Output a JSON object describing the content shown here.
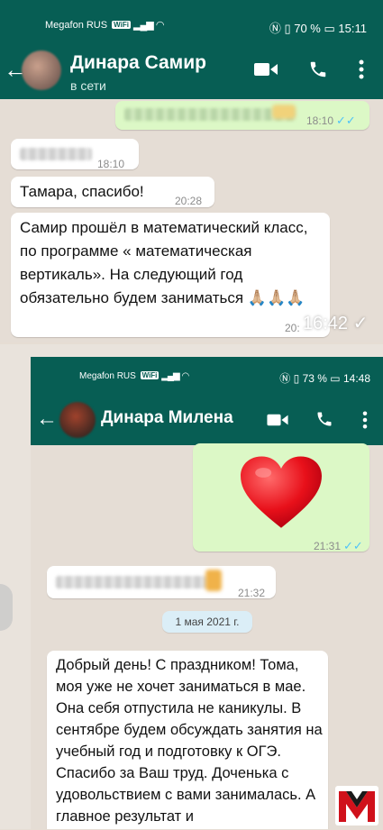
{
  "shot1": {
    "status": {
      "carrier": "Megafon RUS",
      "wifi_badge": "WiFi",
      "battery": "70 %",
      "time": "15:11"
    },
    "header": {
      "name": "Динара Самир",
      "status": "в сети"
    },
    "messages": [
      {
        "time": "18:10"
      },
      {
        "time": "18:10"
      },
      {
        "text": "Тамара, спасибо!",
        "time": "20:28"
      },
      {
        "text": "Самир прошёл в математический класс, по программе « математическая вертикаль». На следующий год обязательно будем заниматься 🙏🏼🙏🏼🙏🏼",
        "time": "20:"
      }
    ],
    "overlay_time": "16:42 ✓"
  },
  "shot2": {
    "status": {
      "carrier": "Megafon RUS",
      "wifi_badge": "WiFi",
      "battery": "73 %",
      "time": "14:48"
    },
    "header": {
      "name": "Динара Милена"
    },
    "messages": [
      {
        "time": "21:31"
      },
      {
        "time": "21:32"
      },
      {
        "text": "Добрый день! С праздником! Тома, моя уже не хочет заниматься в мае. Она себя отпустила не каникулы. В сентябре будем обсуждать занятия на учебный год и подготовку к ОГЭ. Спасибо за Ваш труд. Доченька с удовольствием с вами занималась. А главное результат и"
      }
    ],
    "date_separator": "1 мая 2021 г."
  },
  "colors": {
    "header": "#075e54",
    "outgoing": "#dcf8c6",
    "incoming": "#ffffff",
    "read_ticks": "#4fc3f7",
    "chat_bg": "#e5ddd5"
  },
  "icons": [
    "back-arrow-icon",
    "video-call-icon",
    "phone-icon",
    "more-vert-icon",
    "double-check-icon",
    "heart-emoji",
    "logo-m"
  ]
}
